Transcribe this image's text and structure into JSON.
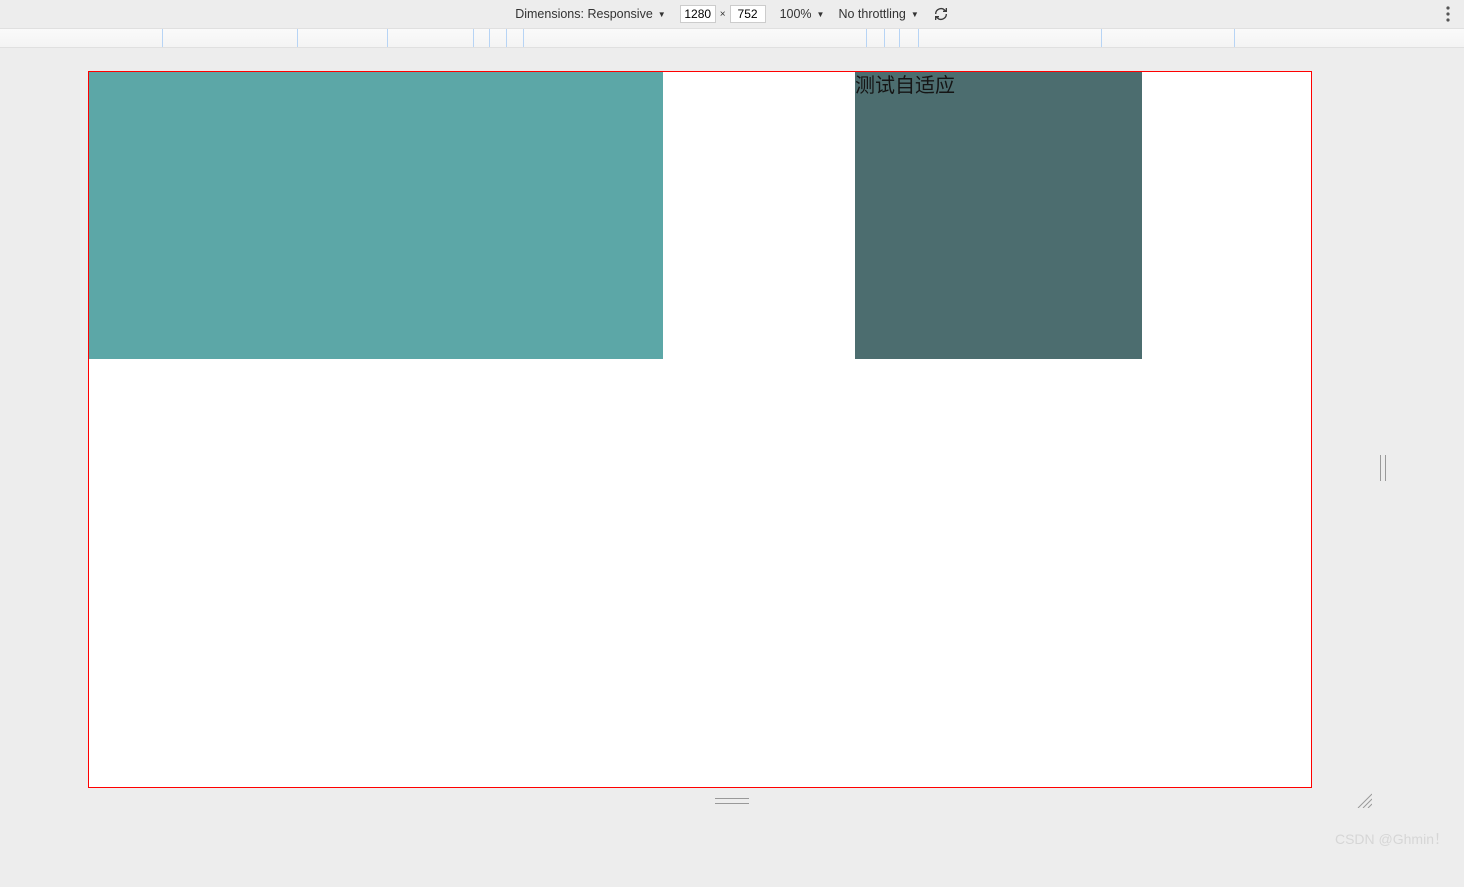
{
  "toolbar": {
    "dimensions_label": "Dimensions:",
    "dimensions_mode": "Responsive",
    "width": "1280",
    "height": "752",
    "zoom": "100%",
    "throttling": "No throttling"
  },
  "ruler": {
    "ticks": [
      162,
      297,
      387,
      473,
      489,
      506,
      523,
      866,
      884,
      899,
      918,
      1101,
      1234
    ]
  },
  "content": {
    "box_text": "测试自适应"
  },
  "watermark": "CSDN @Ghmin！"
}
